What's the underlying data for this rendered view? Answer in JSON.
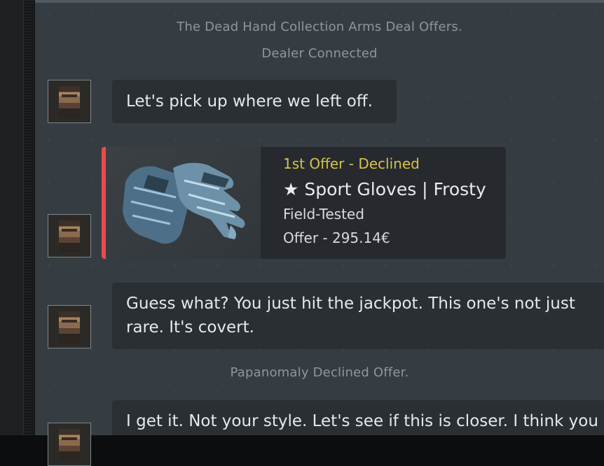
{
  "system_messages": {
    "collection": "The Dead Hand Collection Arms Deal Offers.",
    "connected": "Dealer Connected",
    "declined": "Papanomaly Declined Offer."
  },
  "messages": [
    {
      "text": "Let's pick up where we left off."
    },
    {
      "line1": "Guess what? You just hit the jackpot. This one's not just",
      "line2": "rare. It's covert."
    },
    {
      "text": "I get it. Not your style. Let's see if this is closer. I think you"
    }
  ],
  "offer": {
    "status": "1st Offer - Declined",
    "item_name": "★ Sport Gloves | Frosty",
    "condition": "Field-Tested",
    "price": "Offer - 295.14€",
    "rarity_color": "#eb4b4b",
    "status_color": "#d8c04a",
    "thumbnail_icon": "sport-gloves-frosty-icon"
  }
}
